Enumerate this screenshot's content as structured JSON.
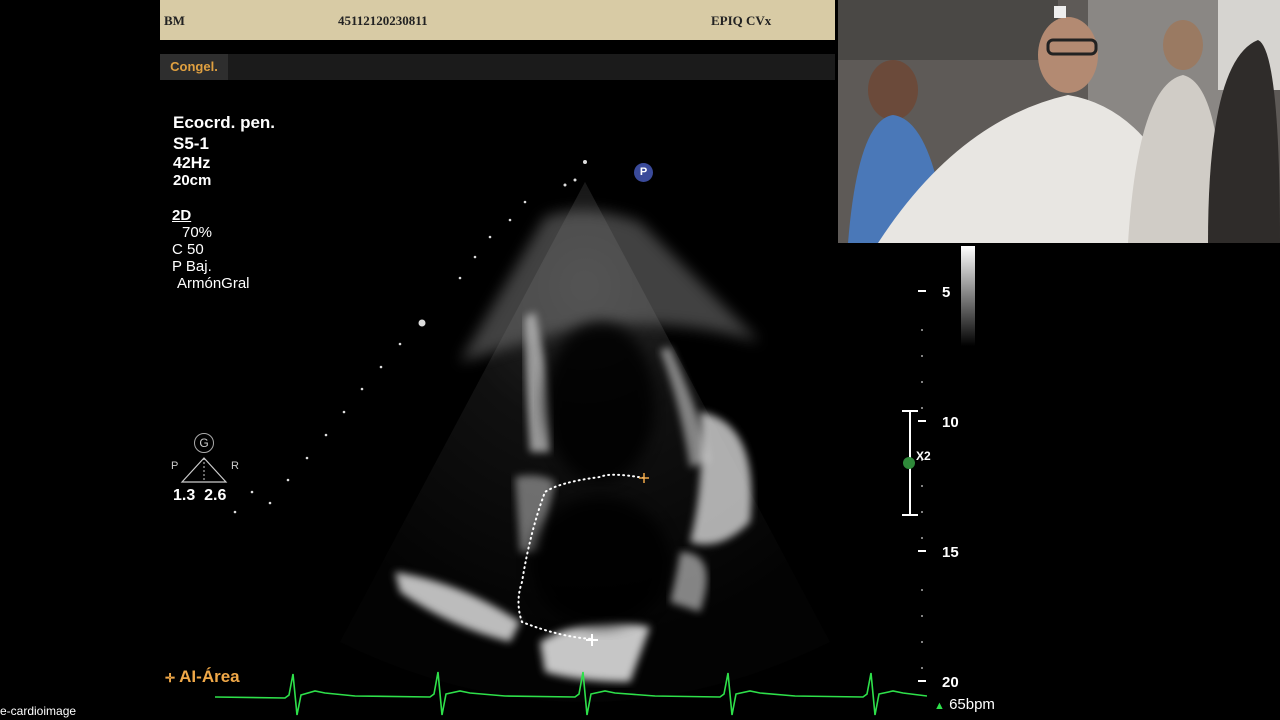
{
  "header": {
    "patient": "BM",
    "exam_id": "45112120230811",
    "system": "EPIQ CVx"
  },
  "frozen_tab": "Congel.",
  "params": {
    "preset": "Ecocrd. pen.",
    "probe": "S5-1",
    "frame_rate": "42Hz",
    "depth": "20cm",
    "mode": "2D",
    "gain": "70%",
    "compression": "C 50",
    "power": "P Baj.",
    "harmonics": "ArmónGral"
  },
  "probe_marker": "P",
  "focus": {
    "icon_label": "G",
    "left_label": "P",
    "right_label": "R",
    "values": "1.3  2.6"
  },
  "depth_scale": {
    "ticks": [
      "5",
      "10",
      "15",
      "20"
    ],
    "zoom_label": "X2"
  },
  "measurement": {
    "label": "AI-Área",
    "icon": "crosshair-icon"
  },
  "heart_rate": "65bpm",
  "watermark": "e-cardioimage",
  "colors": {
    "header_bg": "#d8cba5",
    "tab_text": "#e0a040",
    "ecg_trace": "#2ee04a",
    "measure_label": "#f0a848"
  }
}
